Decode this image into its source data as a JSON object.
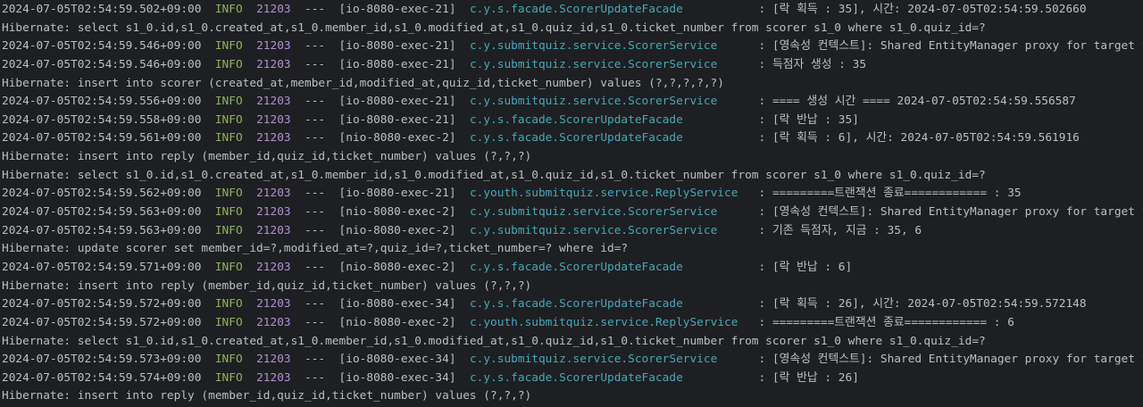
{
  "colors": {
    "background": "#1e1f22",
    "text": "#bcbec4",
    "level_info": "#8fb25c",
    "pid": "#b38fd6",
    "logger": "#45a8b8"
  },
  "lines": [
    {
      "type": "log",
      "ts": "2024-07-05T02:54:59.502+09:00",
      "level": "INFO",
      "pid": "21203",
      "sep": "---",
      "thread": "[io-8080-exec-21]",
      "logger": "c.y.s.facade.ScorerUpdateFacade",
      "msg": ": [락 획득 : 35], 시간: 2024-07-05T02:54:59.502660"
    },
    {
      "type": "raw",
      "text": "Hibernate: select s1_0.id,s1_0.created_at,s1_0.member_id,s1_0.modified_at,s1_0.quiz_id,s1_0.ticket_number from scorer s1_0 where s1_0.quiz_id=?"
    },
    {
      "type": "log",
      "ts": "2024-07-05T02:54:59.546+09:00",
      "level": "INFO",
      "pid": "21203",
      "sep": "---",
      "thread": "[io-8080-exec-21]",
      "logger": "c.y.submitquiz.service.ScorerService",
      "msg": ": [영속성 컨텍스트]: Shared EntityManager proxy for target factory [org.s"
    },
    {
      "type": "log",
      "ts": "2024-07-05T02:54:59.546+09:00",
      "level": "INFO",
      "pid": "21203",
      "sep": "---",
      "thread": "[io-8080-exec-21]",
      "logger": "c.y.submitquiz.service.ScorerService",
      "msg": ": 득점자 생성 : 35"
    },
    {
      "type": "raw",
      "text": "Hibernate: insert into scorer (created_at,member_id,modified_at,quiz_id,ticket_number) values (?,?,?,?,?)"
    },
    {
      "type": "log",
      "ts": "2024-07-05T02:54:59.556+09:00",
      "level": "INFO",
      "pid": "21203",
      "sep": "---",
      "thread": "[io-8080-exec-21]",
      "logger": "c.y.submitquiz.service.ScorerService",
      "msg": ": ==== 생성 시간 ==== 2024-07-05T02:54:59.556587"
    },
    {
      "type": "log",
      "ts": "2024-07-05T02:54:59.558+09:00",
      "level": "INFO",
      "pid": "21203",
      "sep": "---",
      "thread": "[io-8080-exec-21]",
      "logger": "c.y.s.facade.ScorerUpdateFacade",
      "msg": ": [락 반납 : 35]"
    },
    {
      "type": "log",
      "ts": "2024-07-05T02:54:59.561+09:00",
      "level": "INFO",
      "pid": "21203",
      "sep": "---",
      "thread": "[nio-8080-exec-2]",
      "logger": "c.y.s.facade.ScorerUpdateFacade",
      "msg": ": [락 획득 : 6], 시간: 2024-07-05T02:54:59.561916"
    },
    {
      "type": "raw",
      "text": "Hibernate: insert into reply (member_id,quiz_id,ticket_number) values (?,?,?)"
    },
    {
      "type": "raw",
      "text": "Hibernate: select s1_0.id,s1_0.created_at,s1_0.member_id,s1_0.modified_at,s1_0.quiz_id,s1_0.ticket_number from scorer s1_0 where s1_0.quiz_id=?"
    },
    {
      "type": "log",
      "ts": "2024-07-05T02:54:59.562+09:00",
      "level": "INFO",
      "pid": "21203",
      "sep": "---",
      "thread": "[io-8080-exec-21]",
      "logger": "c.youth.submitquiz.service.ReplyService",
      "msg": ": =========트랜잭션 종료============ : 35"
    },
    {
      "type": "log",
      "ts": "2024-07-05T02:54:59.563+09:00",
      "level": "INFO",
      "pid": "21203",
      "sep": "---",
      "thread": "[nio-8080-exec-2]",
      "logger": "c.y.submitquiz.service.ScorerService",
      "msg": ": [영속성 컨텍스트]: Shared EntityManager proxy for target factory [org.s"
    },
    {
      "type": "log",
      "ts": "2024-07-05T02:54:59.563+09:00",
      "level": "INFO",
      "pid": "21203",
      "sep": "---",
      "thread": "[nio-8080-exec-2]",
      "logger": "c.y.submitquiz.service.ScorerService",
      "msg": ": 기존 득점자, 지금 : 35, 6"
    },
    {
      "type": "raw",
      "text": "Hibernate: update scorer set member_id=?,modified_at=?,quiz_id=?,ticket_number=? where id=?"
    },
    {
      "type": "log",
      "ts": "2024-07-05T02:54:59.571+09:00",
      "level": "INFO",
      "pid": "21203",
      "sep": "---",
      "thread": "[nio-8080-exec-2]",
      "logger": "c.y.s.facade.ScorerUpdateFacade",
      "msg": ": [락 반납 : 6]"
    },
    {
      "type": "raw",
      "text": "Hibernate: insert into reply (member_id,quiz_id,ticket_number) values (?,?,?)"
    },
    {
      "type": "log",
      "ts": "2024-07-05T02:54:59.572+09:00",
      "level": "INFO",
      "pid": "21203",
      "sep": "---",
      "thread": "[io-8080-exec-34]",
      "logger": "c.y.s.facade.ScorerUpdateFacade",
      "msg": ": [락 획득 : 26], 시간: 2024-07-05T02:54:59.572148"
    },
    {
      "type": "log",
      "ts": "2024-07-05T02:54:59.572+09:00",
      "level": "INFO",
      "pid": "21203",
      "sep": "---",
      "thread": "[nio-8080-exec-2]",
      "logger": "c.youth.submitquiz.service.ReplyService",
      "msg": ": =========트랜잭션 종료============ : 6"
    },
    {
      "type": "raw",
      "text": "Hibernate: select s1_0.id,s1_0.created_at,s1_0.member_id,s1_0.modified_at,s1_0.quiz_id,s1_0.ticket_number from scorer s1_0 where s1_0.quiz_id=?"
    },
    {
      "type": "log",
      "ts": "2024-07-05T02:54:59.573+09:00",
      "level": "INFO",
      "pid": "21203",
      "sep": "---",
      "thread": "[io-8080-exec-34]",
      "logger": "c.y.submitquiz.service.ScorerService",
      "msg": ": [영속성 컨텍스트]: Shared EntityManager proxy for target factory [org.s"
    },
    {
      "type": "log",
      "ts": "2024-07-05T02:54:59.574+09:00",
      "level": "INFO",
      "pid": "21203",
      "sep": "---",
      "thread": "[io-8080-exec-34]",
      "logger": "c.y.s.facade.ScorerUpdateFacade",
      "msg": ": [락 반납 : 26]"
    },
    {
      "type": "raw",
      "text": "Hibernate: insert into reply (member_id,quiz_id,ticket_number) values (?,?,?)"
    }
  ]
}
